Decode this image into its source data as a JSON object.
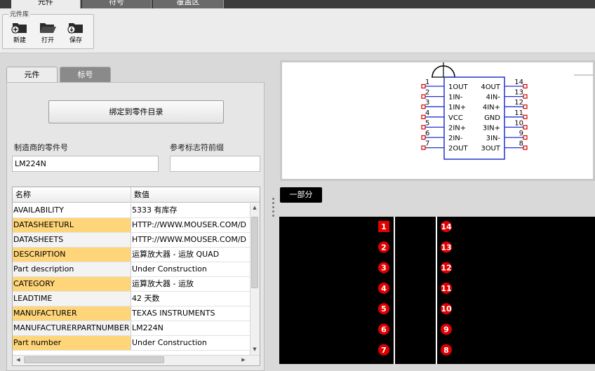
{
  "top_tabs": [
    "元件",
    "符号",
    "覆盖区"
  ],
  "ribbon": {
    "group_label": "元件库",
    "buttons": [
      {
        "label": "新建",
        "icon": "folder-new-icon"
      },
      {
        "label": "打开",
        "icon": "folder-open-icon"
      },
      {
        "label": "保存",
        "icon": "folder-save-icon"
      }
    ]
  },
  "left_tabs": [
    "元件",
    "标号"
  ],
  "bind_button": "绑定到零件目录",
  "mfr_part_label": "制造商的零件号",
  "mfr_part_value": "LM224N",
  "ref_prefix_label": "参考标志符前缀",
  "ref_prefix_value": "",
  "table": {
    "headers": [
      "名称",
      "数值"
    ],
    "rows": [
      {
        "name": "AVAILABILITY",
        "value": "5333 有库存",
        "hl": false
      },
      {
        "name": "DATASHEETURL",
        "value": "HTTP://WWW.MOUSER.COM/D",
        "hl": true
      },
      {
        "name": "DATASHEETS",
        "value": "HTTP://WWW.MOUSER.COM/D",
        "hl": false
      },
      {
        "name": "DESCRIPTION",
        "value": "运算放大器 - 运放 QUAD",
        "hl": true
      },
      {
        "name": "Part description",
        "value": "Under Construction",
        "hl": false
      },
      {
        "name": "CATEGORY",
        "value": "运算放大器 - 运放",
        "hl": true
      },
      {
        "name": "LEADTIME",
        "value": "42 天数",
        "hl": false
      },
      {
        "name": "MANUFACTURER",
        "value": "TEXAS INSTRUMENTS",
        "hl": true
      },
      {
        "name": "MANUFACTURERPARTNUMBER",
        "value": "LM224N",
        "hl": false
      },
      {
        "name": "Part number",
        "value": "Under Construction",
        "hl": true
      }
    ]
  },
  "section_tab": "一部分",
  "symbol": {
    "left_pins": [
      {
        "num": "1",
        "name": "1OUT"
      },
      {
        "num": "2",
        "name": "1IN-"
      },
      {
        "num": "3",
        "name": "1IN+"
      },
      {
        "num": "4",
        "name": "VCC"
      },
      {
        "num": "5",
        "name": "2IN+"
      },
      {
        "num": "6",
        "name": "2IN-"
      },
      {
        "num": "7",
        "name": "2OUT"
      }
    ],
    "right_pins": [
      {
        "num": "14",
        "name": "4OUT"
      },
      {
        "num": "13",
        "name": "4IN-"
      },
      {
        "num": "12",
        "name": "4IN+"
      },
      {
        "num": "11",
        "name": "GND"
      },
      {
        "num": "10",
        "name": "3IN+"
      },
      {
        "num": "9",
        "name": "3IN-"
      },
      {
        "num": "8",
        "name": "3OUT"
      }
    ]
  },
  "footprint": {
    "left_pads": [
      "1",
      "2",
      "3",
      "4",
      "5",
      "6",
      "7"
    ],
    "right_pads": [
      "14",
      "13",
      "12",
      "11",
      "10",
      "9",
      "8"
    ]
  },
  "colors": {
    "highlight_row": "#ffd57a",
    "symbol_body": "#2233cc",
    "pin_end": "#cc0000",
    "pad": "#e00000"
  }
}
